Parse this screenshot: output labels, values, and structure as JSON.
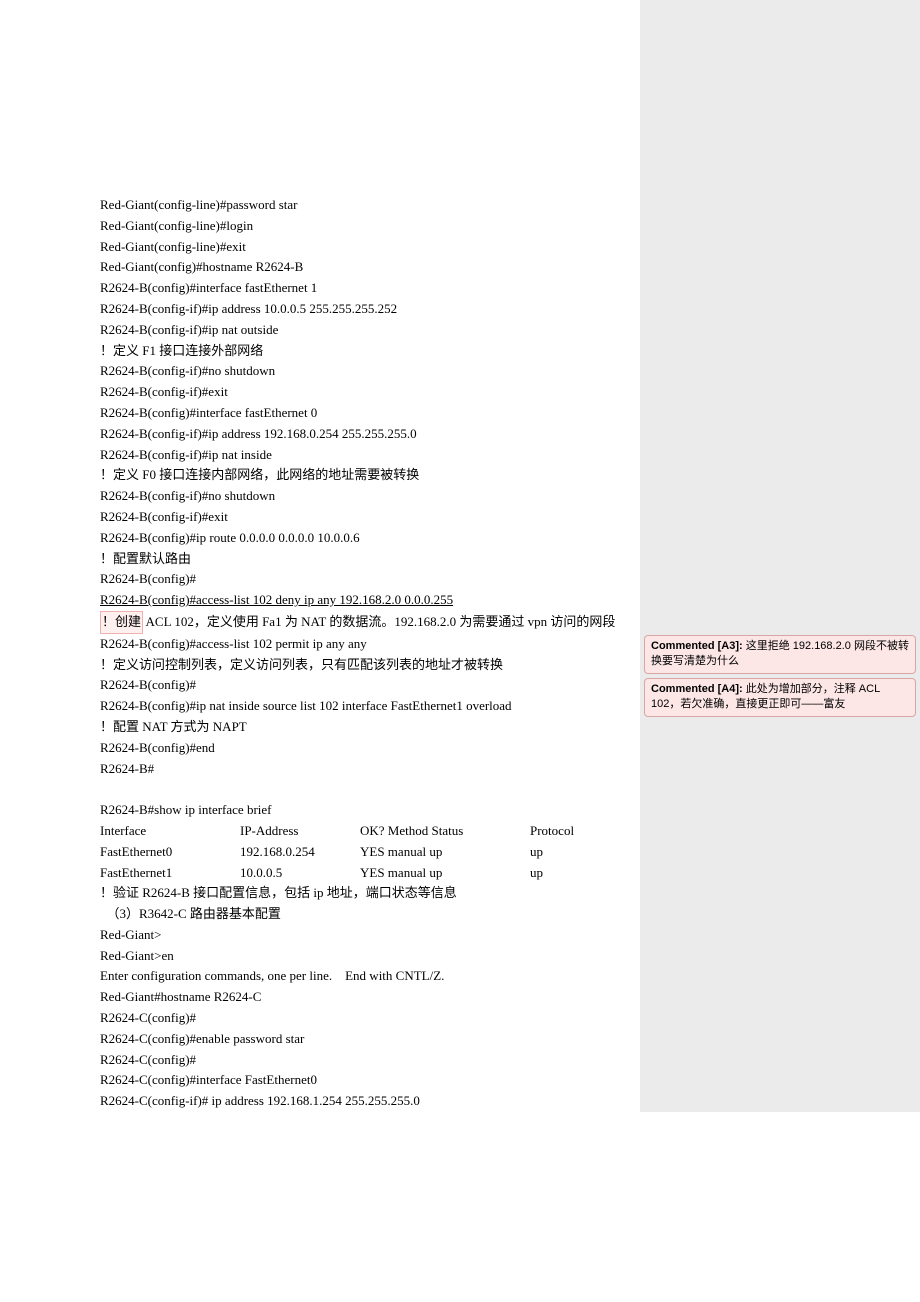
{
  "lines": {
    "l1": "Red-Giant(config-line)#password star",
    "l2": "Red-Giant(config-line)#login",
    "l3": "Red-Giant(config-line)#exit",
    "l4": "Red-Giant(config)#hostname R2624-B",
    "l5": "R2624-B(config)#interface fastEthernet 1",
    "l6": "R2624-B(config-if)#ip address 10.0.0.5 255.255.255.252",
    "l7": "R2624-B(config-if)#ip nat outside",
    "l8": "！定义 F1 接口连接外部网络",
    "l9": "R2624-B(config-if)#no shutdown",
    "l10": "R2624-B(config-if)#exit",
    "l11": "R2624-B(config)#interface fastEthernet 0",
    "l12": "R2624-B(config-if)#ip address 192.168.0.254 255.255.255.0",
    "l13": "R2624-B(config-if)#ip nat inside",
    "l14": "！定义 F0 接口连接内部网络，此网络的地址需要被转换",
    "l15": "R2624-B(config-if)#no shutdown",
    "l16": "R2624-B(config-if)#exit",
    "l17": "R2624-B(config)#ip route 0.0.0.0 0.0.0.0 10.0.0.6",
    "l18": "！配置默认路由",
    "l19": "R2624-B(config)#",
    "l20": "R2624-B(config)#access-list 102 deny ip any 192.168.2.0 0.0.0.255",
    "l21a": "！创建",
    "l21b": " ACL 102，定义使用 Fa1 为 NAT 的数据流。192.168.2.0 为需要通过 vpn 访问的网段",
    "l22": "R2624-B(config)#access-list 102 permit ip any any",
    "l23": "！定义访问控制列表，定义访问列表，只有匹配该列表的地址才被转换",
    "l24": "R2624-B(config)#",
    "l25": "R2624-B(config)#ip nat inside source list 102 interface FastEthernet1 overload",
    "l26": "！配置 NAT 方式为 NAPT",
    "l27": "R2624-B(config)#end",
    "l28": "R2624-B#",
    "l29": "R2624-B#show ip interface brief",
    "th1": "Interface",
    "th2": "IP-Address",
    "th3": "OK? Method Status",
    "th4": "Protocol",
    "r1c1": "FastEthernet0",
    "r1c2": "192.168.0.254",
    "r1c3": "YES manual up",
    "r1c4": "up",
    "r2c1": "FastEthernet1",
    "r2c2": "10.0.0.5",
    "r2c3": "YES manual up",
    "r2c4": "up",
    "l30": "！验证 R2624-B 接口配置信息，包括 ip 地址，端口状态等信息",
    "l31": "  （3）R3642-C 路由器基本配置",
    "l32": "Red-Giant>",
    "l33": "Red-Giant>en",
    "l34": "Enter configuration commands, one per line.    End with CNTL/Z.",
    "l35": "Red-Giant#hostname R2624-C",
    "l36": "R2624-C(config)#",
    "l37": "R2624-C(config)#enable password star",
    "l38": "R2624-C(config)#",
    "l39": "R2624-C(config)#interface FastEthernet0",
    "l40": "R2624-C(config-if)# ip address 192.168.1.254 255.255.255.0"
  },
  "comments": {
    "a3": {
      "label": "Commented [A3]:",
      "text": " 这里拒绝 192.168.2.0 网段不被转换要写清楚为什么"
    },
    "a4": {
      "label": "Commented [A4]:",
      "text": " 此处为增加部分，注释 ACL 102，若欠准确，直接更正即可——富友"
    }
  }
}
